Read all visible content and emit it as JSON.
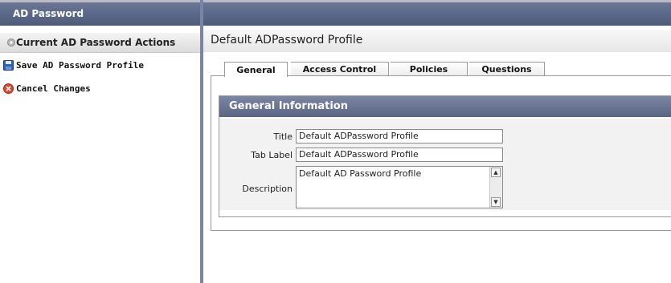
{
  "sidebar": {
    "title": "AD Password",
    "actions_title": "Current AD Password Actions",
    "actions": [
      {
        "label": "Save AD Password Profile",
        "icon": "floppy-disk-icon"
      },
      {
        "label": "Cancel Changes",
        "icon": "cancel-icon"
      }
    ]
  },
  "main": {
    "page_title": "Default ADPassword Profile",
    "tabs": [
      {
        "label": "General",
        "active": true
      },
      {
        "label": "Access Control",
        "active": false
      },
      {
        "label": "Policies",
        "active": false
      },
      {
        "label": "Questions",
        "active": false
      }
    ],
    "section_title": "General Information",
    "fields": {
      "title": {
        "label": "Title",
        "value": "Default ADPassword Profile"
      },
      "tab_label": {
        "label": "Tab Label",
        "value": "Default ADPassword Profile"
      },
      "description": {
        "label": "Description",
        "value": "Default AD Password Profile"
      }
    }
  },
  "colors": {
    "header_bar": "#5a6585",
    "divider": "#7a84a6",
    "section_body": "#f2f2f2"
  }
}
